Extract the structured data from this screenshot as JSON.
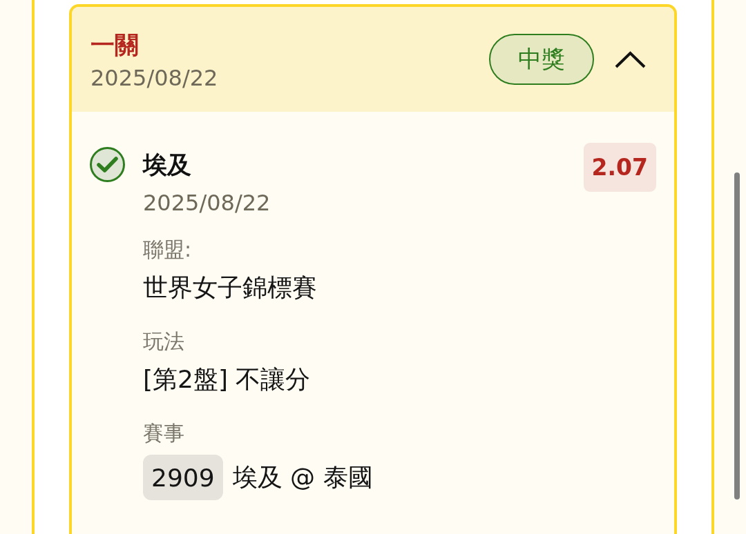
{
  "bet": {
    "title": "一關",
    "date": "2025/08/22",
    "status": {
      "label": "中獎",
      "kind": "won"
    },
    "expanded": true,
    "selections": [
      {
        "team": "埃及",
        "date": "2025/08/22",
        "won": true,
        "odds": "2.07",
        "fields": [
          {
            "kind": "text",
            "label": "聯盟:",
            "value": "世界女子錦標賽"
          },
          {
            "kind": "text",
            "label": "玩法",
            "value": "[第2盤] 不讓分"
          },
          {
            "kind": "match",
            "label": "賽事",
            "code": "2909",
            "value": "埃及 @ 泰國"
          }
        ]
      }
    ]
  }
}
